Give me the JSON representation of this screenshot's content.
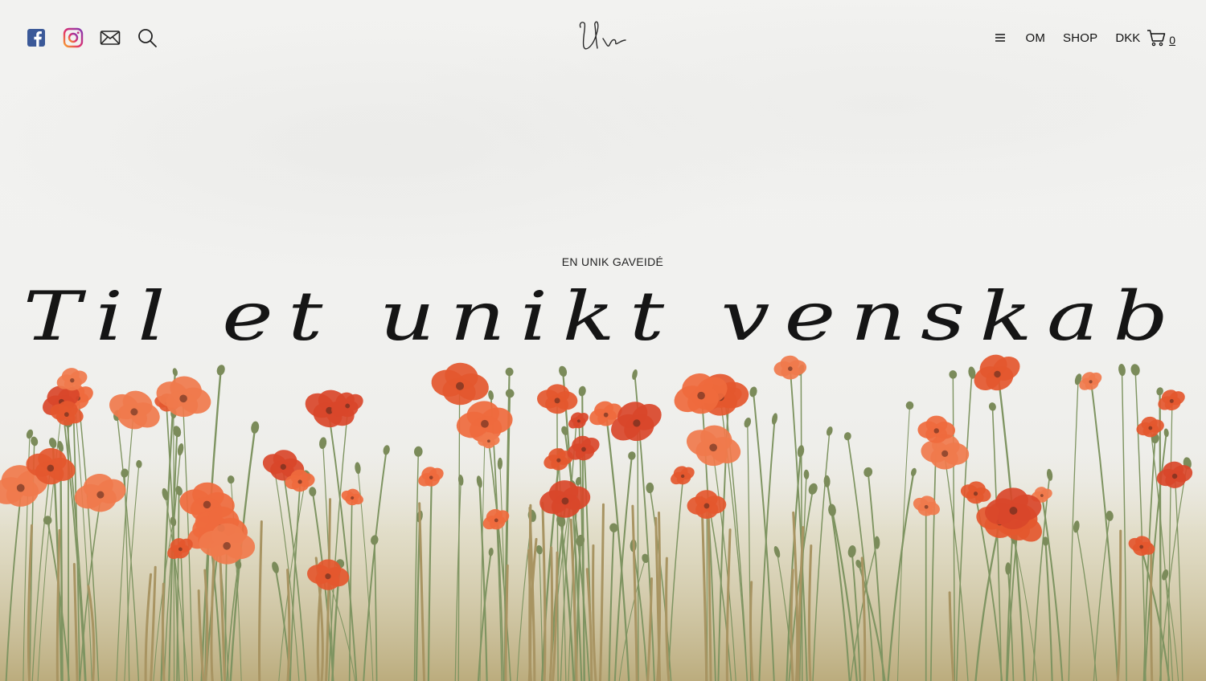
{
  "header": {
    "social_icons": [
      "facebook-icon",
      "instagram-icon",
      "mail-icon",
      "search-icon"
    ],
    "logo_text": "Uv",
    "nav": {
      "menu_icon": "hamburger-icon",
      "about_label": "OM",
      "shop_label": "SHOP",
      "currency_label": "DKK",
      "cart_icon": "cart-icon",
      "cart_count": "0"
    }
  },
  "hero": {
    "eyebrow": "EN UNIK GAVEIDÉ",
    "headline": "Til et unikt venskab"
  },
  "colors": {
    "background": "#f1f1ef",
    "facebook": "#3b5998",
    "poppy": "#e4572e",
    "stem": "#7e9461",
    "text": "#111111"
  }
}
